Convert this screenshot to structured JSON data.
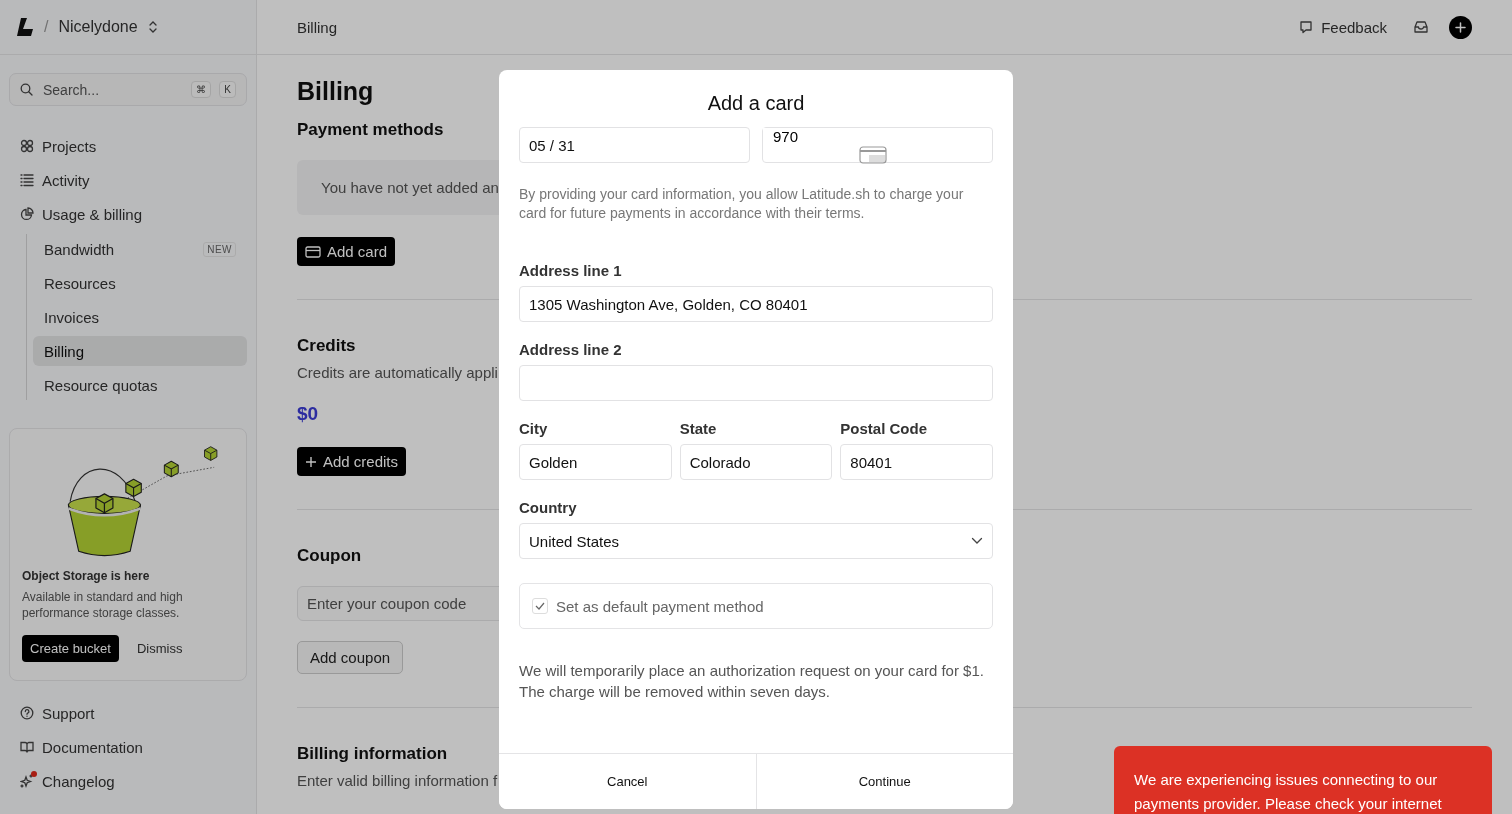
{
  "workspace": {
    "separator": "/",
    "name": "Nicelydone"
  },
  "breadcrumb": "Billing",
  "header": {
    "feedback": "Feedback"
  },
  "sidebar": {
    "search": {
      "placeholder": "Search...",
      "keys": [
        "⌘",
        "K"
      ]
    },
    "nav": [
      {
        "label": "Projects",
        "kind": "grid",
        "selected": false
      },
      {
        "label": "Activity",
        "kind": "list",
        "selected": false
      },
      {
        "label": "Usage & billing",
        "kind": "pie",
        "selected": false,
        "children": [
          {
            "label": "Bandwidth",
            "badge": "NEW",
            "selected": false
          },
          {
            "label": "Resources",
            "selected": false
          },
          {
            "label": "Invoices",
            "selected": false
          },
          {
            "label": "Billing",
            "selected": true
          },
          {
            "label": "Resource quotas",
            "selected": false
          }
        ]
      }
    ],
    "promo": {
      "title": "Object Storage is here",
      "text": "Available in standard and high performance storage classes.",
      "primary": "Create bucket",
      "secondary": "Dismiss"
    },
    "footer": [
      {
        "label": "Support",
        "kind": "help",
        "unread": false
      },
      {
        "label": "Documentation",
        "kind": "book",
        "unread": false
      },
      {
        "label": "Changelog",
        "kind": "sparkle",
        "unread": true
      }
    ]
  },
  "main": {
    "title": "Billing",
    "payment_methods": {
      "heading": "Payment methods",
      "empty_text": "You have not yet added an",
      "button": "Add card"
    },
    "credits": {
      "heading": "Credits",
      "description": "Credits are automatically appli",
      "amount": "$0",
      "button": "Add credits"
    },
    "coupon": {
      "heading": "Coupon",
      "placeholder": "Enter your coupon code",
      "button": "Add coupon"
    },
    "billing_information": {
      "heading": "Billing information",
      "description": "Enter valid billing information f"
    }
  },
  "modal": {
    "title": "Add a card",
    "expiration": {
      "value": "05 / 31"
    },
    "security_code": {
      "value": "970"
    },
    "consent": "By providing your card information, you allow Latitude.sh to charge your card for future payments in accordance with their terms.",
    "address_line_1": {
      "label": "Address line 1",
      "value": "1305 Washington Ave, Golden, CO 80401"
    },
    "address_line_2": {
      "label": "Address line 2"
    },
    "city": {
      "label": "City",
      "value": "Golden"
    },
    "state": {
      "label": "State",
      "value": "Colorado"
    },
    "postal_code": {
      "label": "Postal Code",
      "value": "80401"
    },
    "country": {
      "label": "Country",
      "value": "United States"
    },
    "default_method": {
      "label": "Set as default payment method",
      "checked": true
    },
    "notice": "We will temporarily place an authorization request on your card for $1. The charge will be removed within seven days.",
    "buttons": [
      "Cancel",
      "Continue"
    ]
  },
  "toast": {
    "message": "We are experiencing issues connecting to our payments provider. Please check your internet"
  }
}
